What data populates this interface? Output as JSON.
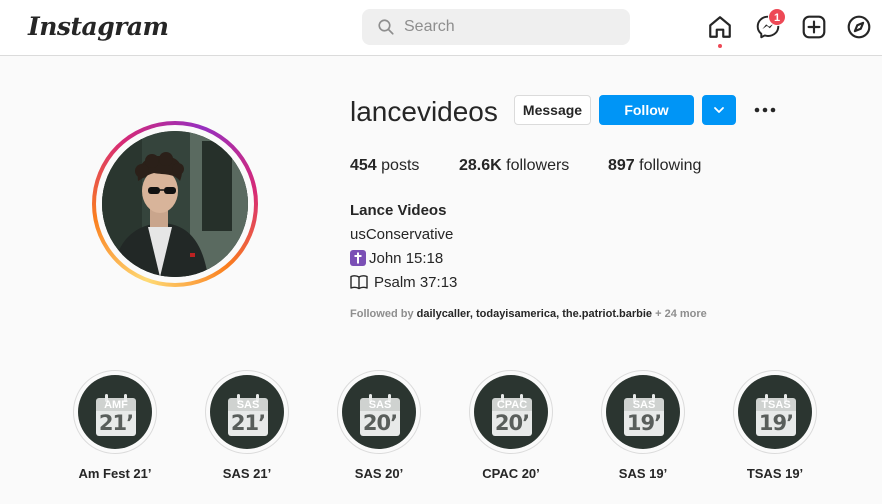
{
  "app": {
    "logo_text": "Instagram"
  },
  "search": {
    "placeholder": "Search"
  },
  "nav": {
    "icons": [
      "home-icon",
      "messenger-icon",
      "new-post-icon",
      "explore-icon"
    ],
    "messenger_badge": "1",
    "accent_color": "#ed4956"
  },
  "profile": {
    "username": "lancevideos",
    "message_label": "Message",
    "follow_label": "Follow",
    "posts_count": "454",
    "posts_label": "posts",
    "followers_count": "28.6K",
    "followers_label": "followers",
    "following_count": "897",
    "following_label": "following",
    "full_name": "Lance Videos",
    "bio": [
      {
        "icon": "cross-icon",
        "text": "usConservative"
      },
      {
        "icon": "cross-icon",
        "text": "John 15:18"
      },
      {
        "icon": "book-icon",
        "text": "Psalm 37:13"
      }
    ],
    "followed_by_prefix": "Followed by",
    "followed_by_accounts": [
      "dailycaller",
      "todayisamerica",
      "the.patriot.barbie"
    ],
    "followed_by_more": "+ 24 more",
    "follow_button_color": "#0095f6"
  },
  "highlights": [
    {
      "tag": "AMF",
      "num": "21’",
      "label": "Am Fest 21’"
    },
    {
      "tag": "SAS",
      "num": "21’",
      "label": "SAS 21’"
    },
    {
      "tag": "SAS",
      "num": "20’",
      "label": "SAS 20’"
    },
    {
      "tag": "CPAC",
      "num": "20’",
      "label": "CPAC 20’"
    },
    {
      "tag": "SAS",
      "num": "19’",
      "label": "SAS 19’"
    },
    {
      "tag": "TSAS",
      "num": "19’",
      "label": "TSAS 19’"
    }
  ]
}
